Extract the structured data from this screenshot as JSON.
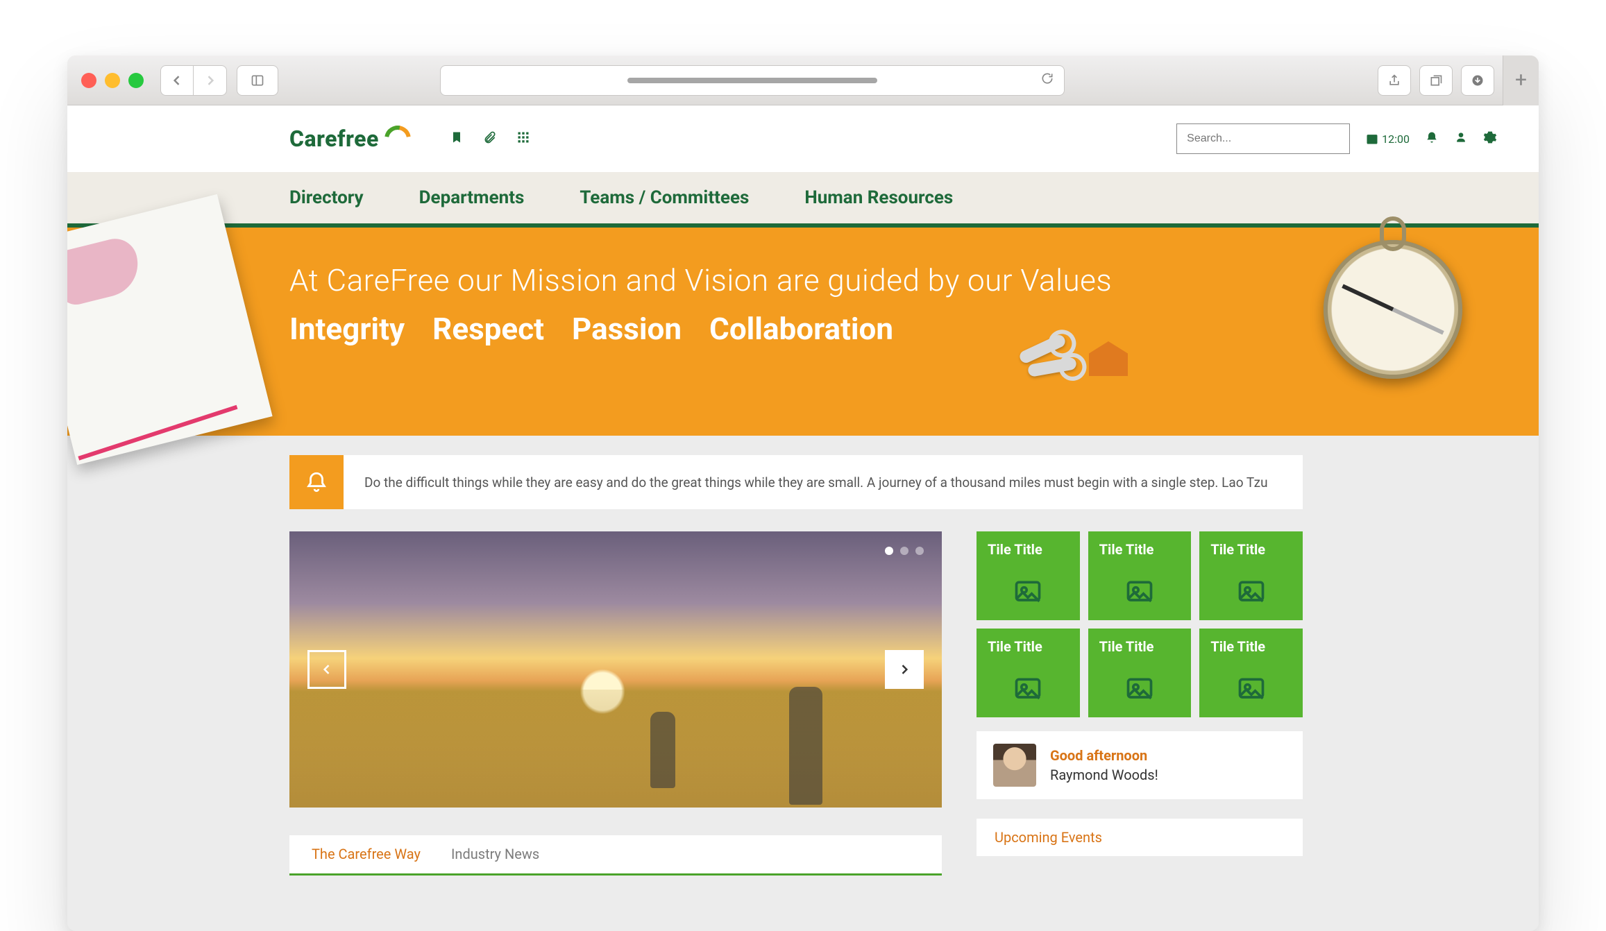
{
  "browser": {
    "new_tab_glyph": "+"
  },
  "brand": {
    "name": "Carefree"
  },
  "header": {
    "search_placeholder": "Search...",
    "time": "12:00"
  },
  "nav": {
    "items": [
      "Directory",
      "Departments",
      "Teams / Committees",
      "Human Resources"
    ]
  },
  "hero": {
    "headline": "At CareFree our Mission and Vision are guided by our Values",
    "values": [
      "Integrity",
      "Respect",
      "Passion",
      "Collaboration"
    ]
  },
  "quote": {
    "text": "Do the difficult things while they are easy and do the great things while they are small. A journey of a thousand miles must begin with a single step. Lao Tzu"
  },
  "carousel": {
    "dots": 3,
    "active_dot": 0
  },
  "tabs": {
    "items": [
      "The Carefree Way",
      "Industry News"
    ],
    "active": 0
  },
  "tiles": [
    {
      "title": "Tile Title"
    },
    {
      "title": "Tile Title"
    },
    {
      "title": "Tile Title"
    },
    {
      "title": "Tile Title"
    },
    {
      "title": "Tile Title"
    },
    {
      "title": "Tile Title"
    }
  ],
  "greeting": {
    "hello": "Good afternoon",
    "name": "Raymond Woods!"
  },
  "events": {
    "title": "Upcoming Events"
  }
}
